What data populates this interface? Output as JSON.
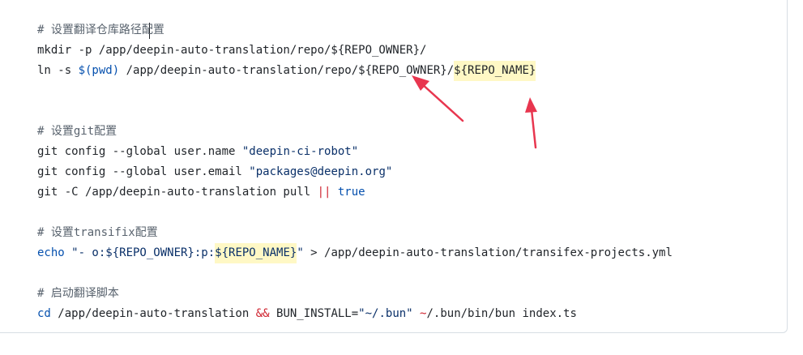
{
  "code": {
    "line1": {
      "comment": "# 设置翻译仓库路径配置"
    },
    "line2": {
      "cmd": "mkdir -p /app/deepin-auto-translation/repo/${REPO_OWNER}/"
    },
    "line3": {
      "a": "ln -s ",
      "b": "$(pwd)",
      "c": " /app/deepin-auto-translation/repo/${REPO_OWNER}/",
      "d": "${REPO_NAME}"
    },
    "line6": {
      "comment": "# 设置git配置"
    },
    "line7": {
      "a": "git config --global user.name ",
      "b": "\"deepin-ci-robot\""
    },
    "line8": {
      "a": "git config --global user.email ",
      "b": "\"packages@deepin.org\""
    },
    "line9": {
      "a": "git -C /app/deepin-auto-translation pull ",
      "b": "||",
      "c": " ",
      "d": "true"
    },
    "line11": {
      "comment": "# 设置transifix配置"
    },
    "line12": {
      "a": "echo",
      "b": " \"- o:${REPO_OWNER}:p:",
      "c": "${REPO_NAME}",
      "d": "\"",
      "e": " > ",
      "f": "/app/deepin-auto-translation/transifex-projects.yml"
    },
    "line14": {
      "comment": "# 启动翻译脚本"
    },
    "line15": {
      "a": "cd",
      "b": " /app/deepin-auto-translation ",
      "c": "&&",
      "d": " BUN_INSTALL=",
      "e": "\"~/.bun\"",
      "f": " ",
      "g": "~",
      "h": "/.bun/bin/bun index.ts"
    }
  },
  "colors": {
    "comment": "#59636e",
    "string": "#0a3069",
    "keyword": "#0550ae",
    "operator": "#cf222e",
    "highlight": "#fff8c5",
    "annotation_arrow": "#e8364f"
  }
}
